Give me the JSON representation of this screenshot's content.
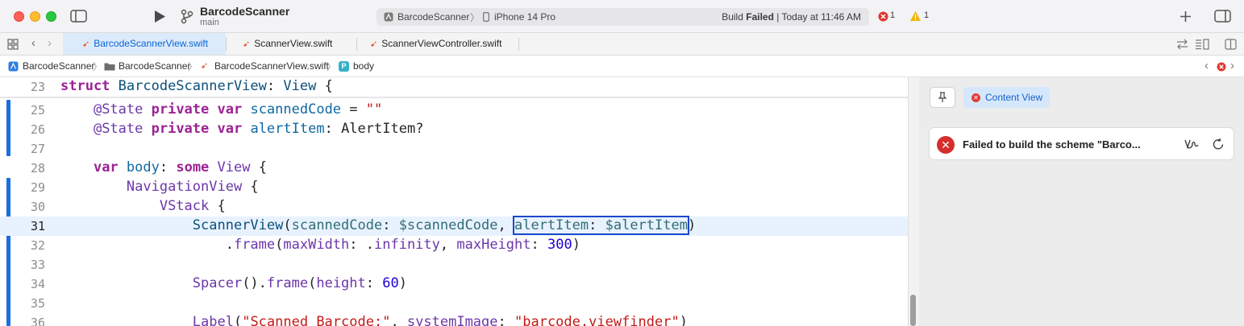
{
  "window": {
    "project_name": "BarcodeScanner",
    "branch": "main"
  },
  "activity": {
    "scheme": "BarcodeScanner",
    "device": "iPhone 14 Pro",
    "build_prefix": "Build ",
    "build_status": "Failed",
    "build_time": " | Today at 11:46 AM",
    "error_count": "1",
    "warning_count": "1"
  },
  "tabs": [
    {
      "label": "BarcodeScannerView.swift",
      "active": true
    },
    {
      "label": "ScannerView.swift",
      "active": false
    },
    {
      "label": "ScannerViewController.swift",
      "active": false
    }
  ],
  "breadcrumb": [
    "BarcodeScanner",
    "BarcodeScanner",
    "BarcodeScannerView.swift",
    "body"
  ],
  "editor": {
    "current_line": 31,
    "line_numbers": [
      "23",
      "25",
      "26",
      "27",
      "28",
      "29",
      "30",
      "31",
      "32",
      "33",
      "34",
      "35",
      "36"
    ]
  },
  "code_tokens": {
    "l23": [
      "struct",
      " BarcodeScannerView",
      ": ",
      "View",
      " {"
    ],
    "l25": [
      "@State",
      " private",
      " var",
      " scannedCode",
      " = ",
      "\"\""
    ],
    "l26": [
      "@State",
      " private",
      " var",
      " alertItem",
      ": ",
      "AlertItem",
      "?"
    ],
    "l28": [
      "var",
      " body",
      ": ",
      "some",
      " View",
      " {"
    ],
    "l29": [
      "NavigationView",
      " {"
    ],
    "l30": [
      "VStack",
      " {"
    ],
    "l31": [
      "ScannerView",
      "(",
      "scannedCode",
      ": ",
      "$scannedCode",
      ", ",
      "alertItem",
      ": ",
      "$alertItem",
      ")"
    ],
    "l32": [
      ".",
      "frame",
      "(",
      "maxWidth",
      ": .",
      "infinity",
      ", ",
      "maxHeight",
      ": ",
      "300",
      ")"
    ],
    "l34": [
      "Spacer",
      "().",
      "frame",
      "(",
      "height",
      ": ",
      "60",
      ")"
    ],
    "l36": [
      "Label",
      "(",
      "\"Scanned Barcode:\"",
      ", ",
      "systemImage",
      ": ",
      "\"barcode.viewfinder\"",
      ")"
    ]
  },
  "preview": {
    "content_view_label": "Content View",
    "error_message": "Failed to build the scheme \"Barco..."
  },
  "icons": {
    "sidebar_toggle": "sidebar-left-icon",
    "run": "play-icon",
    "branch": "branch-icon",
    "add": "plus-icon",
    "inspector": "sidebar-right-icon"
  },
  "colors": {
    "active_tab_text": "#0a64d3",
    "error_red": "#d62d2d",
    "selection_box": "#1c48c9",
    "change_bar": "#1a6fe0"
  }
}
